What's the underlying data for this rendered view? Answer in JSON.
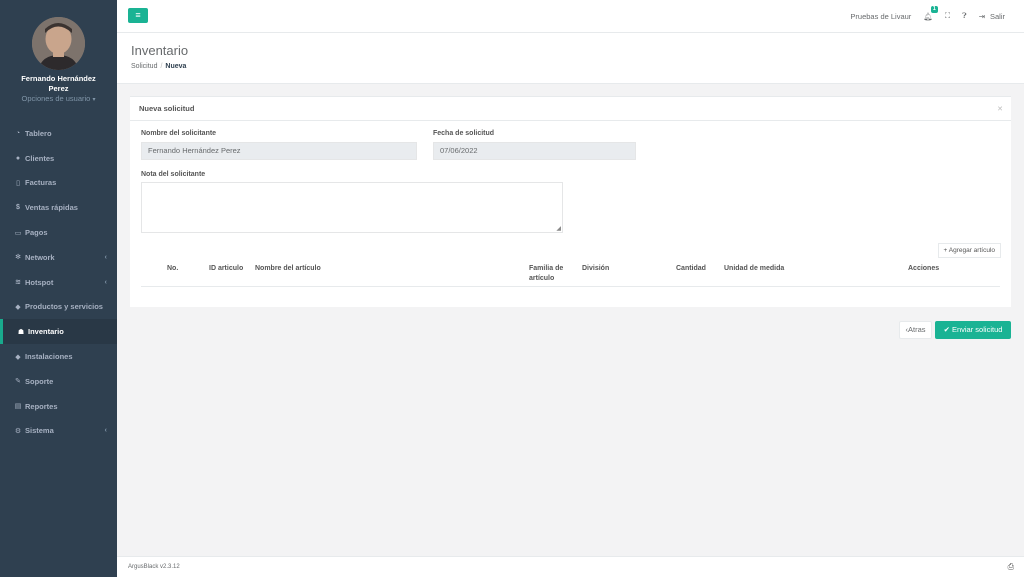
{
  "sidebar": {
    "user_name": "Fernando Hernández Perez",
    "user_options": "Opciones de usuario",
    "items": [
      {
        "label": "Tablero",
        "icon": "dashboard-icon"
      },
      {
        "label": "Clientes",
        "icon": "users-icon"
      },
      {
        "label": "Facturas",
        "icon": "file-icon"
      },
      {
        "label": "Ventas rápidas",
        "icon": "dollar-icon"
      },
      {
        "label": "Pagos",
        "icon": "money-icon"
      },
      {
        "label": "Network",
        "icon": "network-icon"
      },
      {
        "label": "Hotspot",
        "icon": "wifi-icon"
      },
      {
        "label": "Productos y servicios",
        "icon": "tag-icon"
      },
      {
        "label": "Inventario",
        "icon": "boxes-icon"
      },
      {
        "label": "Instalaciones",
        "icon": "tag-icon"
      },
      {
        "label": "Soporte",
        "icon": "wrench-icon"
      },
      {
        "label": "Reportes",
        "icon": "book-icon"
      },
      {
        "label": "Sistema",
        "icon": "cogs-icon"
      }
    ]
  },
  "topbar": {
    "site_name": "Pruebas de Livaur",
    "notification_count": "1",
    "logout_label": "Salir"
  },
  "heading": {
    "title": "Inventario",
    "crumb1": "Solicitud",
    "crumb2": "Nueva"
  },
  "panel": {
    "title": "Nueva solicitud",
    "requester_label": "Nombre del solicitante",
    "requester_value": "Fernando Hernández Perez",
    "date_label": "Fecha de solicitud",
    "date_value": "07/06/2022",
    "note_label": "Nota del solicitante",
    "add_item_label": "Agregar artículo",
    "columns": [
      "No.",
      "ID articulo",
      "Nombre del artículo",
      "Familia de artículo",
      "División",
      "Cantidad",
      "Unidad de medida",
      "Acciones"
    ]
  },
  "actions": {
    "back_label": "Atras",
    "send_label": "Enviar solicitud"
  },
  "footer": {
    "version": "ArgusBlack v2.3.12"
  },
  "colors": {
    "accent": "#1ab394",
    "sidebar": "#2f4050"
  }
}
